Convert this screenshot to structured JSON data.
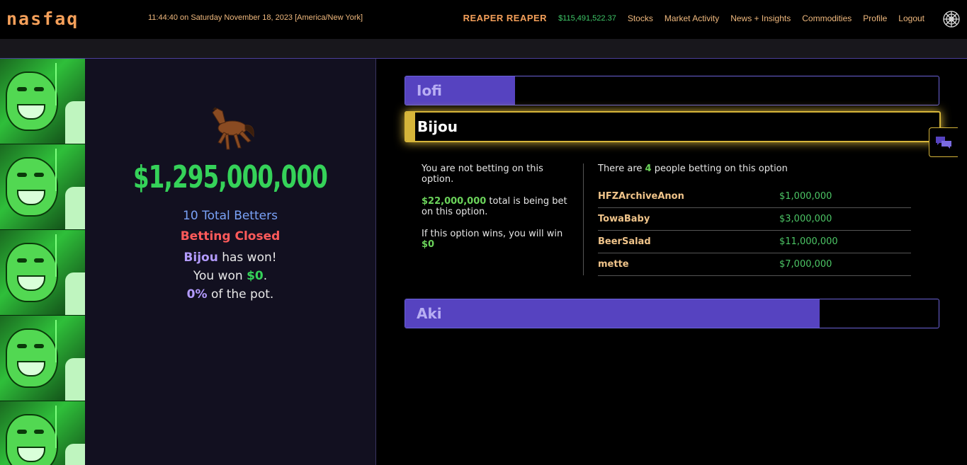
{
  "header": {
    "logo": "nasfaq",
    "clock": "11:44:40 on Saturday November 18, 2023 [America/New York]",
    "username": "REAPER REAPER",
    "balance": "$115,491,522.37",
    "nav": [
      "Stocks",
      "Market Activity",
      "News + Insights",
      "Commodities",
      "Profile",
      "Logout"
    ],
    "settings_icon": "web-icon"
  },
  "pot": {
    "icon": "horse-icon",
    "amount": "$1,295,000,000",
    "betters": "10 Total Betters",
    "status": "Betting Closed",
    "winner_name": "Bijou",
    "winner_suffix": " has won!",
    "you_won_prefix": "You won ",
    "you_won_amount": "$0",
    "you_won_suffix": ".",
    "share_pct": "0%",
    "share_suffix": " of the pot."
  },
  "options": [
    {
      "name": "Iofi",
      "share": 0.206
    },
    {
      "name": "Bijou",
      "share": 0.017,
      "selected": true
    },
    {
      "name": "Aki",
      "share": 0.777
    }
  ],
  "details": {
    "not_betting": "You are not betting on this option.",
    "total_amount": "$22,000,000",
    "total_suffix": " total is being bet on this option.",
    "win_prefix": "If this option wins, you will win",
    "win_amount": "$0",
    "count_prefix": "There are ",
    "count": "4",
    "count_suffix": " people betting on this option",
    "bettors": [
      {
        "name": "HFZArchiveAnon",
        "amount": "$1,000,000"
      },
      {
        "name": "TowaBaby",
        "amount": "$3,000,000"
      },
      {
        "name": "BeerSalad",
        "amount": "$11,000,000"
      },
      {
        "name": "mette",
        "amount": "$7,000,000"
      }
    ]
  },
  "colors": {
    "accent_orange": "#f5a05a",
    "money_green": "#35d259",
    "bar_purple": "#5643c0",
    "selected_gold": "#d6b53a",
    "closed_red": "#ff5a5a"
  },
  "chat_icon": "chat-bubbles-icon"
}
